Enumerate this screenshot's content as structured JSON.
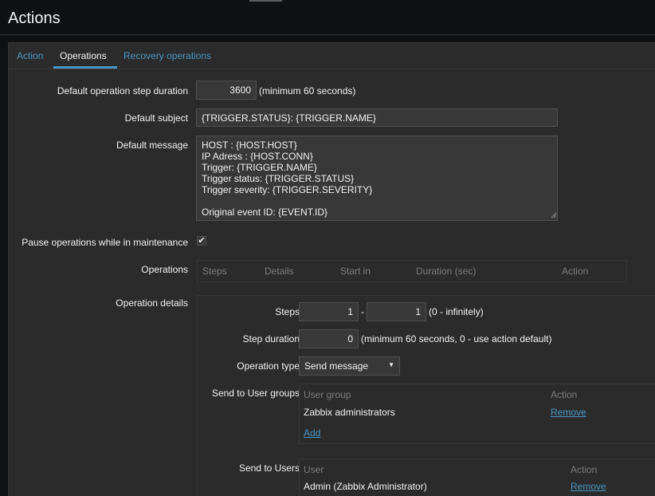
{
  "page": {
    "title": "Actions"
  },
  "tabs": [
    {
      "label": "Action"
    },
    {
      "label": "Operations"
    },
    {
      "label": "Recovery operations"
    }
  ],
  "form": {
    "step_duration": {
      "label": "Default operation step duration",
      "value": "3600",
      "hint": "(minimum 60 seconds)"
    },
    "subject": {
      "label": "Default subject",
      "value": "{TRIGGER.STATUS}: {TRIGGER.NAME}"
    },
    "message": {
      "label": "Default message",
      "value": "HOST : {HOST.HOST}\nIP Adress : {HOST.CONN}\nTrigger: {TRIGGER.NAME}\nTrigger status: {TRIGGER.STATUS}\nTrigger severity: {TRIGGER.SEVERITY}\n\nOriginal event ID: {EVENT.ID}"
    },
    "pause": {
      "label": "Pause operations while in maintenance",
      "checked": true,
      "check_glyph": "✔"
    },
    "operations": {
      "label": "Operations",
      "columns": [
        "Steps",
        "Details",
        "Start in",
        "Duration (sec)",
        "Action"
      ]
    },
    "details": {
      "label": "Operation details",
      "steps": {
        "label": "Steps",
        "from": "1",
        "separator": "-",
        "to": "1",
        "hint": "(0 - infinitely)"
      },
      "step_duration": {
        "label": "Step duration",
        "value": "0",
        "hint": "(minimum 60 seconds, 0 - use action default)"
      },
      "operation_type": {
        "label": "Operation type",
        "value": "Send message"
      },
      "user_groups": {
        "label": "Send to User groups",
        "columns": [
          "User group",
          "Action"
        ],
        "rows": [
          {
            "name": "Zabbix administrators",
            "action": "Remove"
          }
        ],
        "add_label": "Add"
      },
      "users": {
        "label": "Send to Users",
        "columns": [
          "User",
          "Action"
        ],
        "rows": [
          {
            "name": "Admin (Zabbix Administrator)",
            "action": "Remove"
          }
        ]
      }
    }
  },
  "colors": {
    "background": "#0e1012",
    "panel": "#2b2b2b",
    "accent": "#4796c4",
    "muted": "#7c7c7c"
  }
}
